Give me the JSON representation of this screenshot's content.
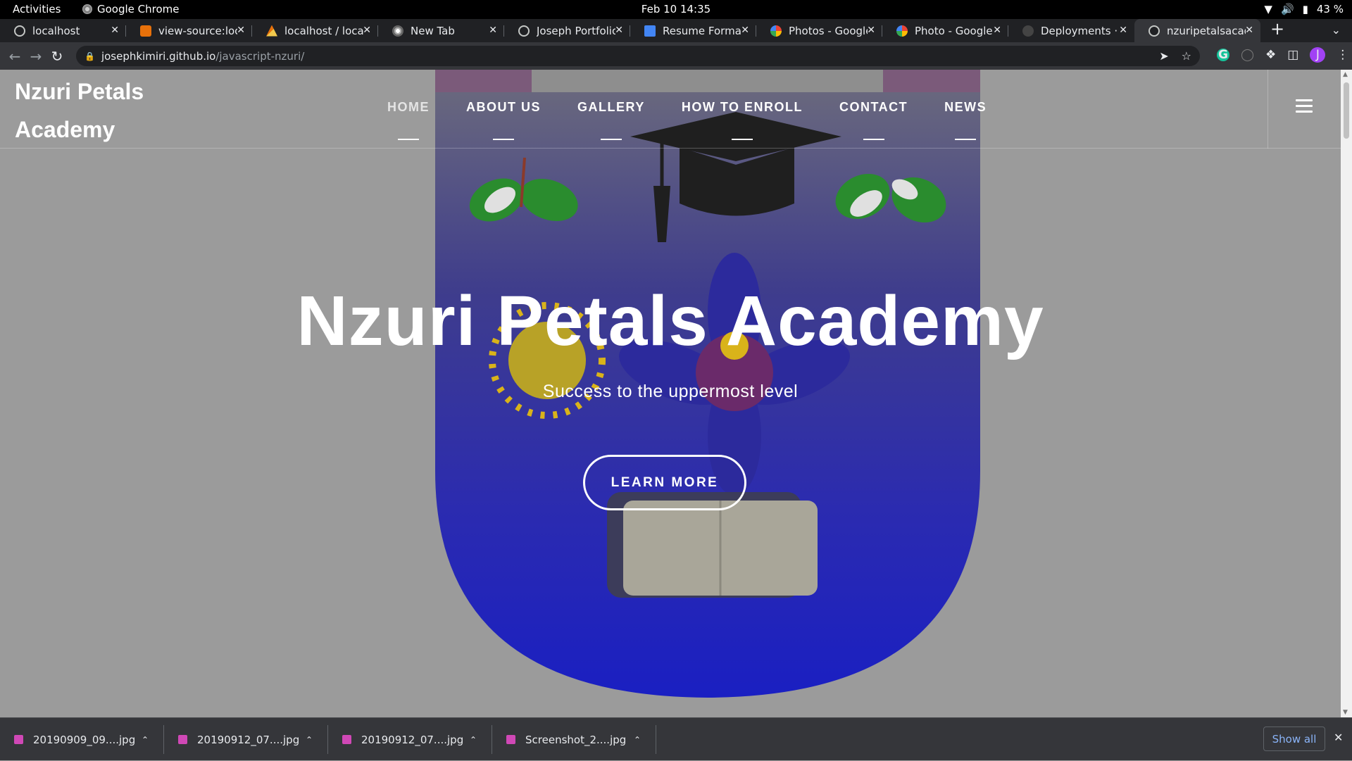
{
  "system": {
    "activities": "Activities",
    "app_name": "Google Chrome",
    "clock": "Feb 10  14:35",
    "battery": "43 %"
  },
  "tabs": [
    {
      "title": "localhost",
      "icon": "globe-icon"
    },
    {
      "title": "view-source:loca",
      "icon": "source-icon"
    },
    {
      "title": "localhost / localh",
      "icon": "phpmyadmin-icon"
    },
    {
      "title": "New Tab",
      "icon": "chrome-icon"
    },
    {
      "title": "Joseph Portfolio",
      "icon": "globe-icon"
    },
    {
      "title": "Resume Format",
      "icon": "docs-icon"
    },
    {
      "title": "Photos - Google P",
      "icon": "photos-icon"
    },
    {
      "title": "Photo - Google P",
      "icon": "photos-icon"
    },
    {
      "title": "Deployments · jo",
      "icon": "github-icon"
    },
    {
      "title": "nzuripetalsacade",
      "icon": "globe-icon",
      "active": true
    }
  ],
  "address_bar": {
    "host": "josephkimiri.github.io",
    "path": "/javascript-nzuri/"
  },
  "site": {
    "brand": "Nzuri Petals Academy",
    "nav": [
      "HOME",
      "ABOUT US",
      "GALLERY",
      "HOW TO ENROLL",
      "CONTACT",
      "NEWS"
    ],
    "active_nav": "HOME",
    "hero_title": "Nzuri Petals Academy",
    "hero_subtitle": "Success to the uppermost level",
    "cta": "LEARN MORE"
  },
  "downloads": {
    "items": [
      "20190909_09....jpg",
      "20190912_07....jpg",
      "20190912_07....jpg",
      "Screenshot_2....jpg"
    ],
    "show_all": "Show all"
  },
  "colors": {
    "overlay": "#9b9b9b",
    "crest_blue": "#1f23b4",
    "crest_maroon": "#7b3a5c",
    "leaf_green": "#2a8c2e",
    "sun_yellow": "#d9b31a"
  }
}
